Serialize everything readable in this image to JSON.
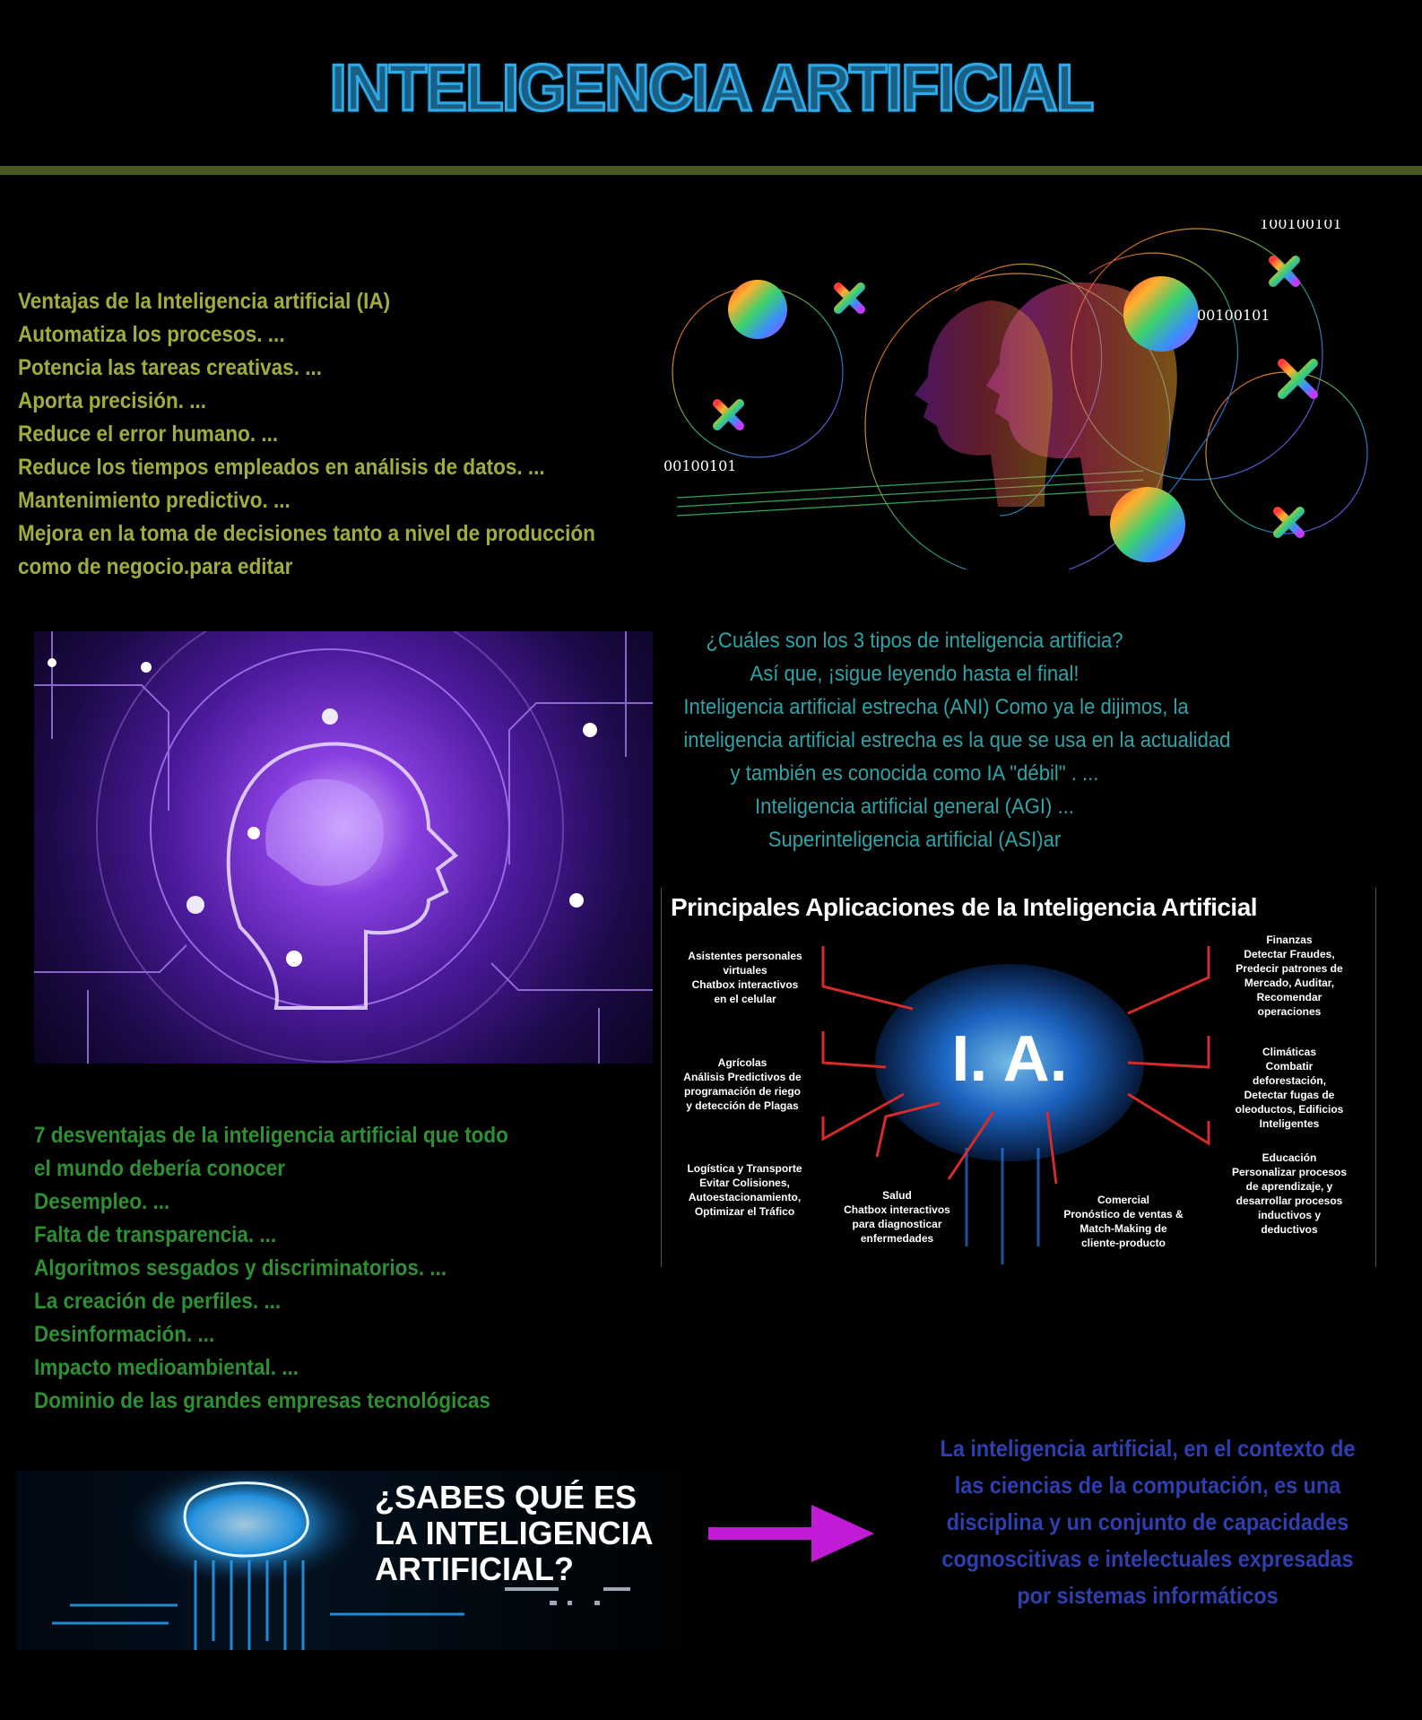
{
  "title": "INTELIGENCIA ARTIFICIAL",
  "colors": {
    "title_fill": "#1a5f86",
    "title_stroke": "#2fa8e6",
    "divider": "#4a5a1f",
    "ventajas_text": "#a0ad3e",
    "tipos_text": "#2fa3a6",
    "desventajas_text": "#2f8f33",
    "definicion_text": "#2e3fb0",
    "arrow": "#c21bd6"
  },
  "ventajas": {
    "lines": [
      "Ventajas de la Inteligencia artificial (IA)",
      "Automatiza los procesos. ...",
      "Potencia las tareas creativas. ...",
      "Aporta precisión. ...",
      "Reduce el error humano. ...",
      "Reduce los tiempos empleados en análisis de datos. ...",
      "Mantenimiento predictivo. ...",
      "Mejora en la toma de decisiones tanto a nivel de producción",
      "como de negocio.para editar"
    ]
  },
  "tipos": {
    "lines": [
      "¿Cuáles son los 3 tipos de inteligencia artificia?",
      "Así que, ¡sigue leyendo hasta el final!",
      "Inteligencia artificial estrecha (ANI) Como ya le dijimos, la",
      "inteligencia artificial estrecha es la que se usa en la actualidad",
      "y también es conocida como IA \"débil\" . ...",
      "Inteligencia artificial general (AGI) ...",
      "Superinteligencia artificial (ASI)ar"
    ]
  },
  "desventajas": {
    "lines": [
      "7 desventajas de la inteligencia artificial que todo",
      "el mundo debería conocer",
      "Desempleo. ...",
      "Falta de transparencia. ...",
      "Algoritmos sesgados y discriminatorios. ...",
      "La creación de perfiles. ...",
      "Desinformación. ...",
      "Impacto medioambiental. ...",
      "Dominio de las grandes empresas tecnológicas"
    ]
  },
  "definicion": {
    "lines": [
      "La inteligencia artificial, en el contexto de",
      "las ciencias de la computación, es una",
      "disciplina y un conjunto de capacidades",
      "cognoscitivas e intelectuales expresadas",
      "por sistemas informáticos"
    ]
  },
  "heads_image": {
    "binary_top": "100100101",
    "binary_mid": "00100101",
    "binary_left": "00100101"
  },
  "applications": {
    "title": "Principales Aplicaciones de la Inteligencia Artificial",
    "center_label": "I. A.",
    "asistentes": [
      "Asistentes personales",
      "virtuales",
      "Chatbox interactivos",
      "en el celular"
    ],
    "agricolas": [
      "Agrícolas",
      "Análisis Predictivos de",
      "programación de riego",
      "y detección de Plagas"
    ],
    "logistica": [
      "Logística y Transporte",
      "Evitar Colisiones,",
      "Autoestacionamiento,",
      "Optimizar el Tráfico"
    ],
    "salud": [
      "Salud",
      "Chatbox interactivos",
      "para diagnosticar",
      "enfermedades"
    ],
    "comercial": [
      "Comercial",
      "Pronóstico de ventas &",
      "Match-Making de",
      "cliente-producto"
    ],
    "finanzas": [
      "Finanzas",
      "Detectar Fraudes,",
      "Predecir patrones de",
      "Mercado, Auditar,",
      "Recomendar",
      "operaciones"
    ],
    "climaticas": [
      "Climáticas",
      "Combatir",
      "deforestación,",
      "Detectar fugas de",
      "oleoductos, Edificios",
      "Inteligentes"
    ],
    "educacion": [
      "Educación",
      "Personalizar procesos",
      "de aprendizaje, y",
      "desarrollar procesos",
      "inductivos y",
      "deductivos"
    ]
  },
  "sabes": {
    "lines": [
      "¿SABES QUÉ ES",
      "LA INTELIGENCIA",
      "ARTIFICIAL?"
    ]
  }
}
